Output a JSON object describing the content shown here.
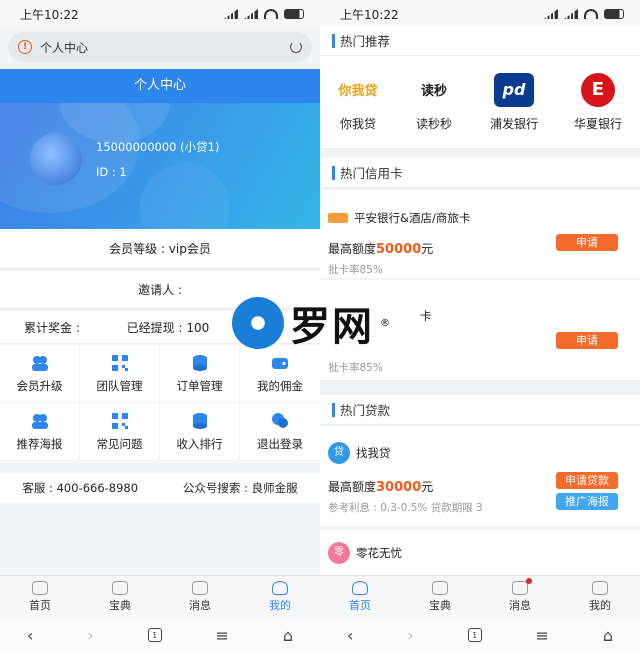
{
  "status_bar": {
    "time": "上午10:22"
  },
  "left": {
    "url_bar": {
      "title": "个人中心"
    },
    "header": {
      "title": "个人中心"
    },
    "profile": {
      "phone": "15000000000 (小贷1)",
      "id": "ID : 1"
    },
    "member_level": "会员等级 : vip会员",
    "inviter": "邀请人 :",
    "bonus": {
      "total_label": "累计奖金 :",
      "withdrawn_label": "已经提现 : 100"
    },
    "grid": [
      {
        "label": "会员升级",
        "icon": "user-upgrade-icon"
      },
      {
        "label": "团队管理",
        "icon": "qrcode-icon"
      },
      {
        "label": "订单管理",
        "icon": "coins-icon"
      },
      {
        "label": "我的佣金",
        "icon": "wallet-icon"
      },
      {
        "label": "推荐海报",
        "icon": "users-icon"
      },
      {
        "label": "常见问题",
        "icon": "qrcode-icon"
      },
      {
        "label": "收入排行",
        "icon": "coins-icon"
      },
      {
        "label": "退出登录",
        "icon": "chat-icon"
      }
    ],
    "service": {
      "phone": "客服 : 400-666-8980",
      "wechat": "公众号搜索 : 良师金服"
    }
  },
  "tabs": [
    {
      "label": "首页",
      "icon": "home-icon"
    },
    {
      "label": "宝典",
      "icon": "wallet-icon"
    },
    {
      "label": "消息",
      "icon": "message-icon"
    },
    {
      "label": "我的",
      "icon": "user-icon"
    }
  ],
  "right": {
    "hot_recommend": {
      "title": "热门推荐",
      "items": [
        {
          "label": "你我贷",
          "logo_text": "你我贷",
          "color": "#e8a317"
        },
        {
          "label": "读秒秒",
          "logo_text": "读秒",
          "color": "#222222"
        },
        {
          "label": "浦发银行",
          "logo_text": "pd",
          "color": "#0b3b8f"
        },
        {
          "label": "华夏银行",
          "logo_text": "E",
          "color": "#d7141a"
        }
      ]
    },
    "hot_cards": {
      "title": "热门信用卡",
      "items": [
        {
          "name": "平安银行&酒店/商旅卡",
          "limit_prefix": "最高额度",
          "limit_amount": "50000",
          "limit_suffix": "元",
          "rate": "批卡率85%",
          "button": "申请"
        },
        {
          "name": "卡",
          "limit_prefix": "",
          "limit_amount": "",
          "limit_suffix": "",
          "rate": "批卡率85%",
          "button": "申请"
        }
      ]
    },
    "hot_loans": {
      "title": "热门贷款",
      "items": [
        {
          "name": "找我贷",
          "icon_text": "贷",
          "limit_prefix": "最高额度",
          "limit_amount": "30000",
          "limit_suffix": "元",
          "detail": "参考利息 : 0.3-0.5% 贷款期限 3",
          "button_apply": "申请贷款",
          "button_poster": "推广海报"
        },
        {
          "name": "零花无忧",
          "icon_text": "零"
        }
      ]
    }
  },
  "watermark": {
    "text": "罗网",
    "mark": "®"
  }
}
